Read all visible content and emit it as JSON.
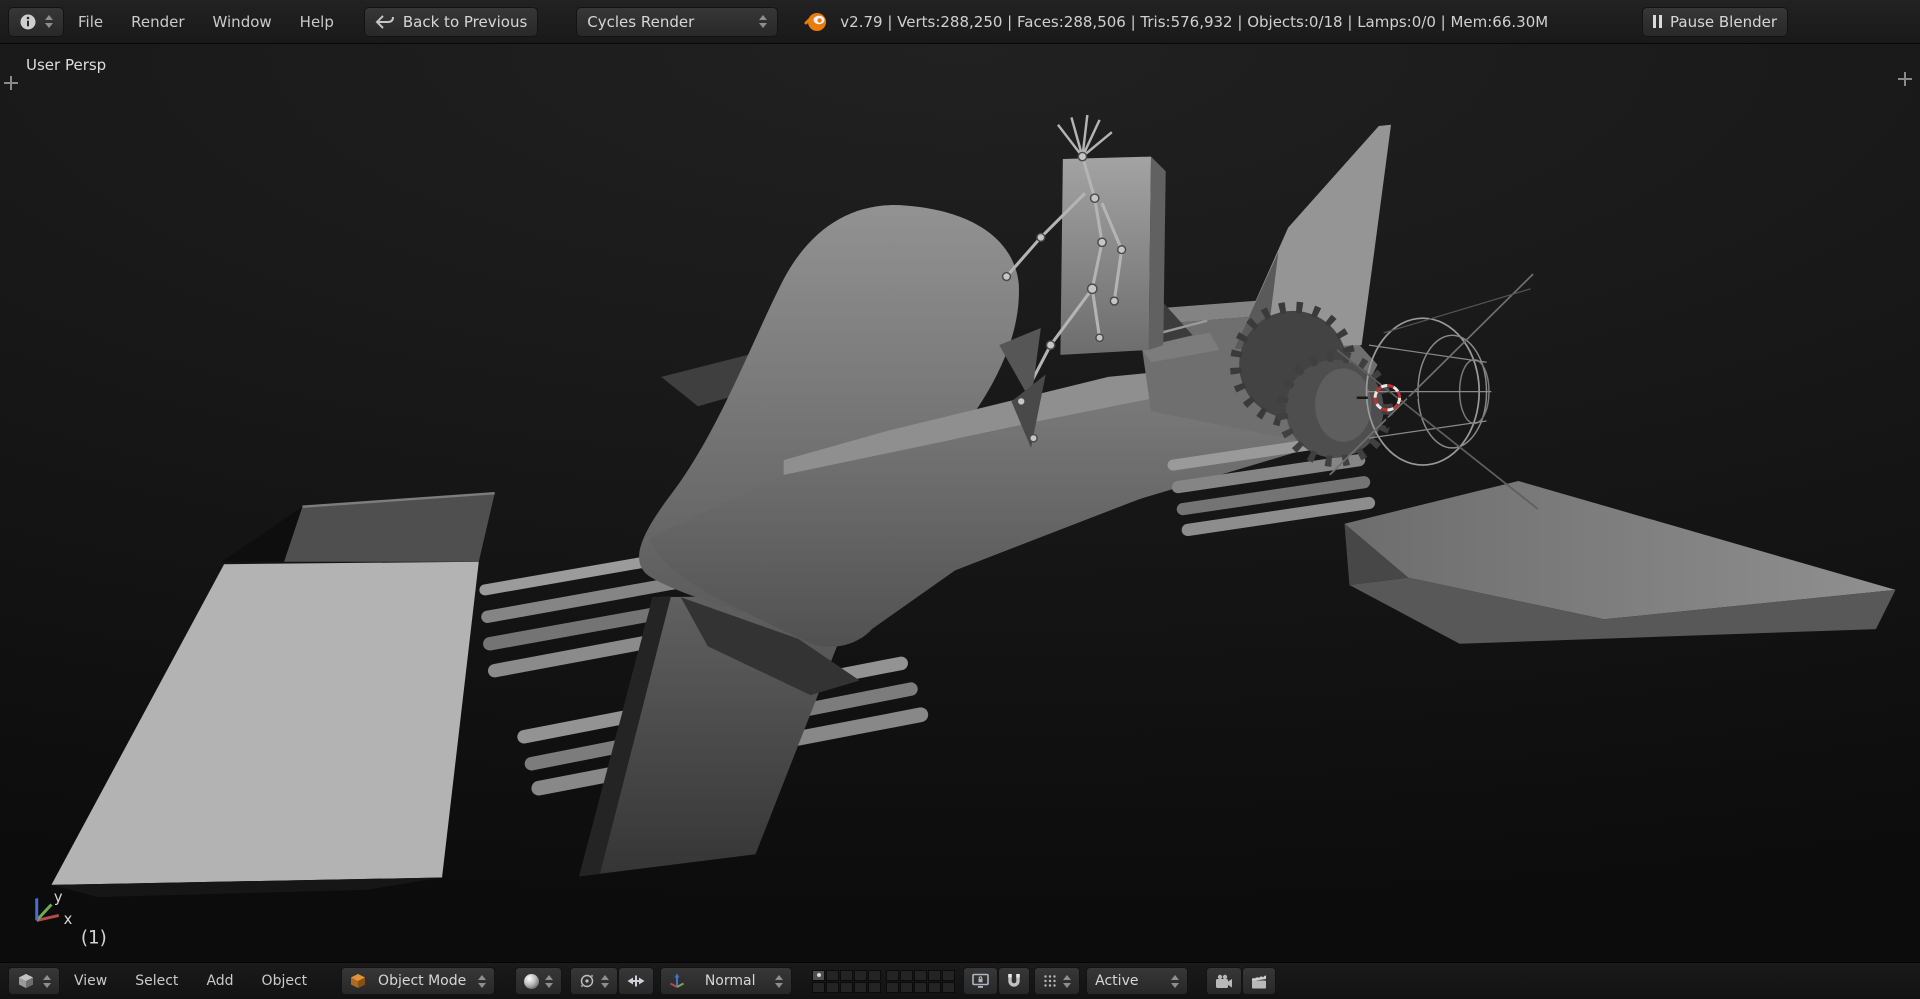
{
  "colors": {
    "accent": "#e87d0d",
    "cursor_red": "#c03030",
    "axis_x": "#b54b4b",
    "axis_y": "#6fae4f",
    "axis_z": "#4a6fd4"
  },
  "top_bar": {
    "menus": [
      "File",
      "Render",
      "Window",
      "Help"
    ],
    "back_button_label": "Back to Previous",
    "render_engine": "Cycles Render",
    "stats": "v2.79 | Verts:288,250 | Faces:288,506 | Tris:576,932 | Objects:0/18 | Lamps:0/0 | Mem:66.30M",
    "pause_button_label": "Pause Blender"
  },
  "viewport": {
    "view_label": "User Persp",
    "layer_indicator": "(1)",
    "axis_labels": {
      "x": "x",
      "y": "y"
    }
  },
  "bottom_bar": {
    "menus": [
      "View",
      "Select",
      "Add",
      "Object"
    ],
    "mode": "Object Mode",
    "orientation": "Normal",
    "snap_target": "Active",
    "layers": {
      "groups": 2,
      "rows": 2,
      "cols": 5,
      "active_index": 0
    }
  },
  "icons": {
    "top_left_editor": "info-icon",
    "back": "back-arrow-icon",
    "logo": "blender-logo-icon",
    "pause": "pause-icon",
    "bottom_left_editor": "viewport-cube-icon",
    "mode": "object-cube-icon",
    "shading": "sphere-icon",
    "pivot": "pivot-median-icon",
    "center_points": "center-points-icon",
    "orientation": "axis-icon",
    "lock": "screen-lock-icon",
    "snap": "magnet-icon",
    "snap_element": "increment-snap-icon",
    "render_still": "camera-icon",
    "render_animation": "clapperboard-icon"
  }
}
